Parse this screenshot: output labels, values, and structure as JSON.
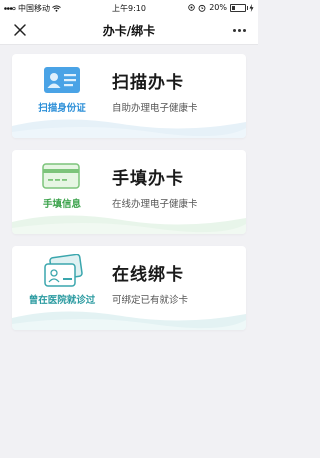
{
  "status_bar": {
    "carrier": "中国移动",
    "time": "上午9:10",
    "battery": "20%"
  },
  "nav": {
    "title": "办卡/绑卡"
  },
  "cards": [
    {
      "icon": "id-card-icon",
      "icon_label": "扫描身份证",
      "title": "扫描办卡",
      "subtitle": "自助办理电子健康卡",
      "accent": "#2c8fd8"
    },
    {
      "icon": "card-edit-icon",
      "icon_label": "手填信息",
      "title": "手填办卡",
      "subtitle": "在线办理电子健康卡",
      "accent": "#3aa24a"
    },
    {
      "icon": "hospital-card-icon",
      "icon_label": "曾在医院就诊过",
      "title": "在线绑卡",
      "subtitle": "可绑定已有就诊卡",
      "accent": "#2a9aa0"
    }
  ]
}
